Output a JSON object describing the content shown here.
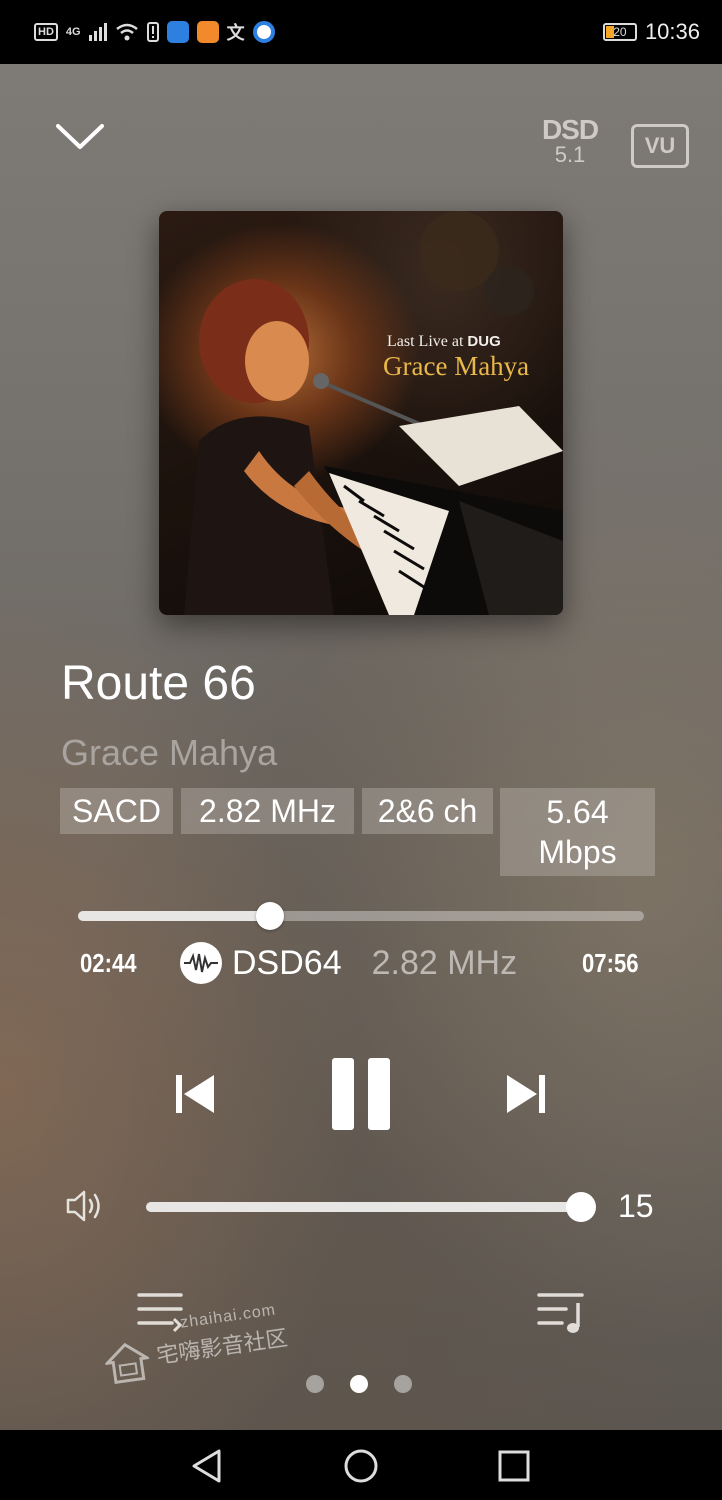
{
  "status_bar": {
    "left_icons": [
      "HD",
      "4G",
      "signal-icon",
      "wifi-icon",
      "alert-icon",
      "cloud-app-icon",
      "video-app-icon",
      "wen-app-icon",
      "browser-app-icon"
    ],
    "network": "4G",
    "hd": "HD",
    "wen": "文",
    "battery": "20",
    "time": "10:36"
  },
  "header": {
    "dsd_badge_top": "DSD",
    "dsd_badge_bottom": "5.1",
    "vu_label": "VU"
  },
  "album_cover": {
    "line1_prefix": "Last Live at ",
    "line1_venue": "DUG",
    "line2": "Grace Mahya"
  },
  "track": {
    "title": "Route 66",
    "artist": "Grace Mahya",
    "tags": [
      "SACD",
      "2.82 MHz",
      "2&6 ch"
    ],
    "bitrate_value": "5.64",
    "bitrate_unit": "Mbps"
  },
  "playback": {
    "elapsed": "02:44",
    "total": "07:56",
    "progress_fraction": 0.34,
    "format": "DSD64",
    "sample_rate": "2.82 MHz",
    "state": "playing"
  },
  "volume": {
    "value": "15",
    "fraction": 1.0
  },
  "page_indicator": {
    "count": 3,
    "active_index": 1
  },
  "watermark": {
    "url": "zhaihai.com",
    "text": "宅嗨影音社区"
  },
  "colors": {
    "background": "#736f6a",
    "accent": "#ffffff",
    "muted_text": "#a9a49f",
    "battery_low": "#f5a623",
    "cover_gold_text": "#e9b84a"
  }
}
